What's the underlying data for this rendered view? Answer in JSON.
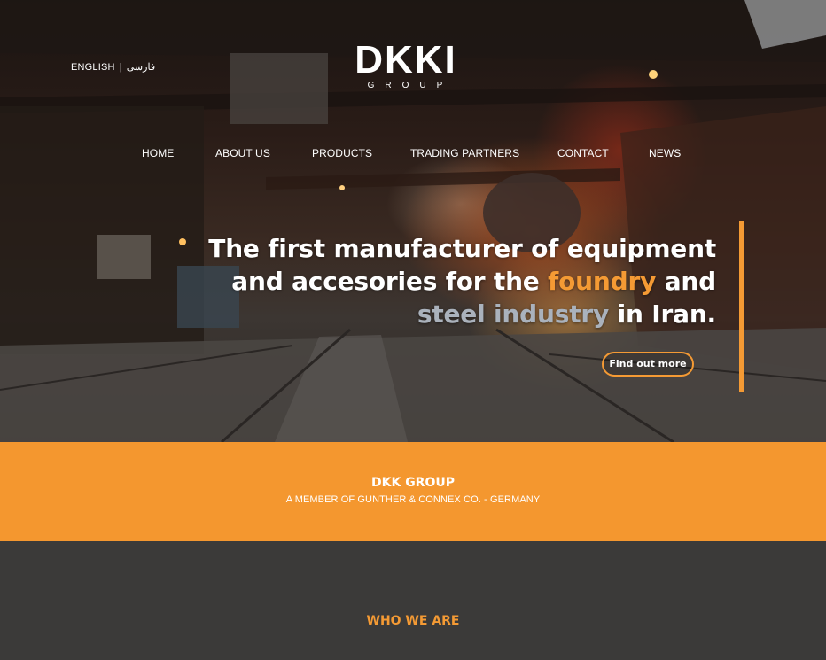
{
  "header": {
    "languages": [
      "ENGLISH",
      "فارسی"
    ],
    "logo_text": "DKKI",
    "logo_subtitle": "GROUP"
  },
  "nav": {
    "items": [
      "HOME",
      "ABOUT US",
      "PRODUCTS",
      "TRADING PARTNERS",
      "CONTACT",
      "NEWS"
    ]
  },
  "hero": {
    "headline": {
      "line1": "The first manufacturer of equipment",
      "line2_a": "and accesories for the",
      "line2_orange": "foundry",
      "line2_b": "and",
      "line3_grey": "steel industry",
      "line3_b": "in Iran."
    },
    "cta_label": "Find out more"
  },
  "band": {
    "title": "DKK GROUP",
    "subtitle": "A MEMBER OF GUNTHER & CONNEX CO. - GERMANY"
  },
  "section": {
    "heading": "WHO WE ARE"
  },
  "colors": {
    "accent": "#f49a34",
    "band_bg": "#f4972f",
    "dark_bg": "#3b3a39",
    "highlight_grey": "#aab2bc"
  }
}
